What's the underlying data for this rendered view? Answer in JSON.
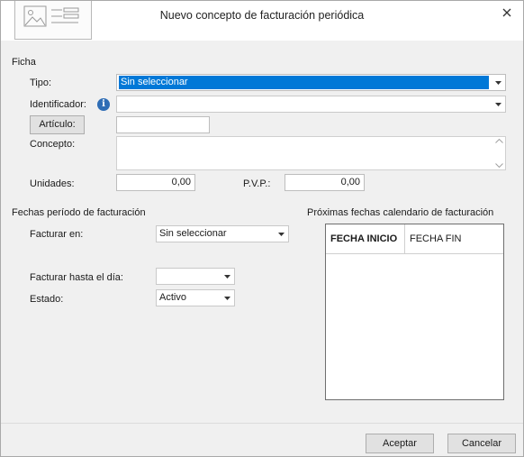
{
  "window": {
    "title": "Nuevo concepto de facturación periódica",
    "close_icon": "close-icon"
  },
  "ficha": {
    "section_title": "Ficha",
    "tipo_label": "Tipo:",
    "tipo_value": "Sin seleccionar",
    "identificador_label": "Identificador:",
    "identificador_value": "",
    "articulo_button": "Artículo:",
    "articulo_value": "",
    "concepto_label": "Concepto:",
    "concepto_value": "",
    "unidades_label": "Unidades:",
    "unidades_value": "0,00",
    "pvp_label": "P.V.P.:",
    "pvp_value": "0,00"
  },
  "periodo": {
    "section_title": "Fechas período de facturación",
    "facturar_en_label": "Facturar en:",
    "facturar_en_value": "Sin seleccionar",
    "facturar_hasta_label": "Facturar hasta el día:",
    "facturar_hasta_value": "",
    "estado_label": "Estado:",
    "estado_value": "Activo"
  },
  "calendario": {
    "section_title": "Próximas fechas calendario de facturación",
    "columns": [
      "FECHA INICIO",
      "FECHA FIN"
    ]
  },
  "footer": {
    "accept_label": "Aceptar",
    "cancel_label": "Cancelar"
  }
}
